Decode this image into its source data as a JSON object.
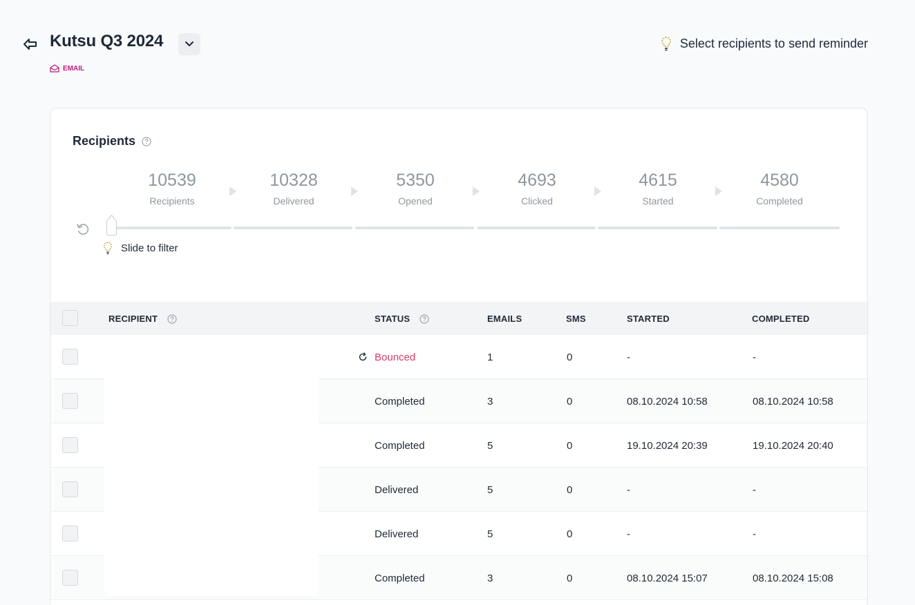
{
  "header": {
    "title": "Kutsu Q3 2024",
    "channel": "EMAIL",
    "hint": "Select recipients to send reminder"
  },
  "funnel": {
    "title": "Recipients",
    "stages": [
      {
        "value": "10539",
        "label": "Recipients"
      },
      {
        "value": "10328",
        "label": "Delivered"
      },
      {
        "value": "5350",
        "label": "Opened"
      },
      {
        "value": "4693",
        "label": "Clicked"
      },
      {
        "value": "4615",
        "label": "Started"
      },
      {
        "value": "4580",
        "label": "Completed"
      }
    ],
    "slider_hint": "Slide to filter"
  },
  "table": {
    "columns": {
      "recipient": "RECIPIENT",
      "status": "STATUS",
      "emails": "EMAILS",
      "sms": "SMS",
      "started": "STARTED",
      "completed": "COMPLETED"
    },
    "rows": [
      {
        "status": "Bounced",
        "emails": "1",
        "sms": "0",
        "started": "-",
        "completed": "-"
      },
      {
        "status": "Completed",
        "emails": "3",
        "sms": "0",
        "started": "08.10.2024 10:58",
        "completed": "08.10.2024 10:58"
      },
      {
        "status": "Completed",
        "emails": "5",
        "sms": "0",
        "started": "19.10.2024 20:39",
        "completed": "19.10.2024 20:40"
      },
      {
        "status": "Delivered",
        "emails": "5",
        "sms": "0",
        "started": "-",
        "completed": "-"
      },
      {
        "status": "Delivered",
        "emails": "5",
        "sms": "0",
        "started": "-",
        "completed": "-"
      },
      {
        "status": "Completed",
        "emails": "3",
        "sms": "0",
        "started": "08.10.2024 15:07",
        "completed": "08.10.2024 15:08"
      }
    ]
  },
  "colors": {
    "accent": "#c0197a",
    "bounced": "#d43c6b",
    "hint_icon": "#c9a227"
  }
}
